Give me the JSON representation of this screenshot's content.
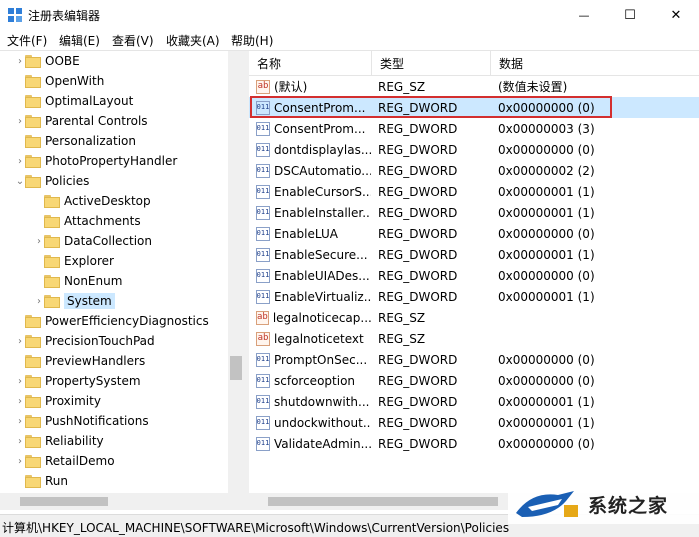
{
  "window": {
    "title": "注册表编辑器",
    "minimize_glyph": "—",
    "maximize_glyph": "☐",
    "close_glyph": "✕"
  },
  "menu": [
    "文件(F)",
    "编辑(E)",
    "查看(V)",
    "收藏夹(A)",
    "帮助(H)"
  ],
  "tree": {
    "items": [
      {
        "label": "OOBE",
        "expander": ">",
        "level": 1
      },
      {
        "label": "OpenWith",
        "expander": "",
        "level": 1
      },
      {
        "label": "OptimalLayout",
        "expander": "",
        "level": 1
      },
      {
        "label": "Parental Controls",
        "expander": ">",
        "level": 1
      },
      {
        "label": "Personalization",
        "expander": "",
        "level": 1
      },
      {
        "label": "PhotoPropertyHandler",
        "expander": ">",
        "level": 1
      },
      {
        "label": "Policies",
        "expander": "v",
        "level": 1
      },
      {
        "label": "ActiveDesktop",
        "expander": "",
        "level": 2
      },
      {
        "label": "Attachments",
        "expander": "",
        "level": 2
      },
      {
        "label": "DataCollection",
        "expander": ">",
        "level": 2
      },
      {
        "label": "Explorer",
        "expander": "",
        "level": 2
      },
      {
        "label": "NonEnum",
        "expander": "",
        "level": 2
      },
      {
        "label": "System",
        "expander": ">",
        "level": 2,
        "selected": true
      },
      {
        "label": "PowerEfficiencyDiagnostics",
        "expander": "",
        "level": 1
      },
      {
        "label": "PrecisionTouchPad",
        "expander": ">",
        "level": 1
      },
      {
        "label": "PreviewHandlers",
        "expander": "",
        "level": 1
      },
      {
        "label": "PropertySystem",
        "expander": ">",
        "level": 1
      },
      {
        "label": "Proximity",
        "expander": ">",
        "level": 1
      },
      {
        "label": "PushNotifications",
        "expander": ">",
        "level": 1
      },
      {
        "label": "Reliability",
        "expander": ">",
        "level": 1
      },
      {
        "label": "RetailDemo",
        "expander": ">",
        "level": 1
      },
      {
        "label": "Run",
        "expander": "",
        "level": 1
      }
    ]
  },
  "list": {
    "headers": {
      "name": "名称",
      "type": "类型",
      "data": "数据"
    },
    "rows": [
      {
        "icon": "ab",
        "name": "(默认)",
        "type": "REG_SZ",
        "data": "(数值未设置)"
      },
      {
        "icon": "dw",
        "name": "ConsentProm...",
        "type": "REG_DWORD",
        "data": "0x00000000 (0)",
        "selected": true
      },
      {
        "icon": "dw",
        "name": "ConsentProm...",
        "type": "REG_DWORD",
        "data": "0x00000003 (3)"
      },
      {
        "icon": "dw",
        "name": "dontdisplaylas...",
        "type": "REG_DWORD",
        "data": "0x00000000 (0)"
      },
      {
        "icon": "dw",
        "name": "DSCAutomatio...",
        "type": "REG_DWORD",
        "data": "0x00000002 (2)"
      },
      {
        "icon": "dw",
        "name": "EnableCursorS...",
        "type": "REG_DWORD",
        "data": "0x00000001 (1)"
      },
      {
        "icon": "dw",
        "name": "EnableInstaller...",
        "type": "REG_DWORD",
        "data": "0x00000001 (1)"
      },
      {
        "icon": "dw",
        "name": "EnableLUA",
        "type": "REG_DWORD",
        "data": "0x00000000 (0)"
      },
      {
        "icon": "dw",
        "name": "EnableSecure...",
        "type": "REG_DWORD",
        "data": "0x00000001 (1)"
      },
      {
        "icon": "dw",
        "name": "EnableUIADes...",
        "type": "REG_DWORD",
        "data": "0x00000000 (0)"
      },
      {
        "icon": "dw",
        "name": "EnableVirtualiz...",
        "type": "REG_DWORD",
        "data": "0x00000001 (1)"
      },
      {
        "icon": "ab",
        "name": "legalnoticecap...",
        "type": "REG_SZ",
        "data": ""
      },
      {
        "icon": "ab",
        "name": "legalnoticetext",
        "type": "REG_SZ",
        "data": ""
      },
      {
        "icon": "dw",
        "name": "PromptOnSec...",
        "type": "REG_DWORD",
        "data": "0x00000000 (0)"
      },
      {
        "icon": "dw",
        "name": "scforceoption",
        "type": "REG_DWORD",
        "data": "0x00000000 (0)"
      },
      {
        "icon": "dw",
        "name": "shutdownwith...",
        "type": "REG_DWORD",
        "data": "0x00000001 (1)"
      },
      {
        "icon": "dw",
        "name": "undockwithout...",
        "type": "REG_DWORD",
        "data": "0x00000001 (1)"
      },
      {
        "icon": "dw",
        "name": "ValidateAdmin...",
        "type": "REG_DWORD",
        "data": "0x00000000 (0)"
      }
    ]
  },
  "status": {
    "path": "计算机\\HKEY_LOCAL_MACHINE\\SOFTWARE\\Microsoft\\Windows\\CurrentVersion\\Policies"
  },
  "watermark": {
    "text": "系统之家"
  },
  "colors": {
    "selection": "#cce8ff",
    "highlight_border": "#d32f2f",
    "folder": "#f8d775"
  }
}
